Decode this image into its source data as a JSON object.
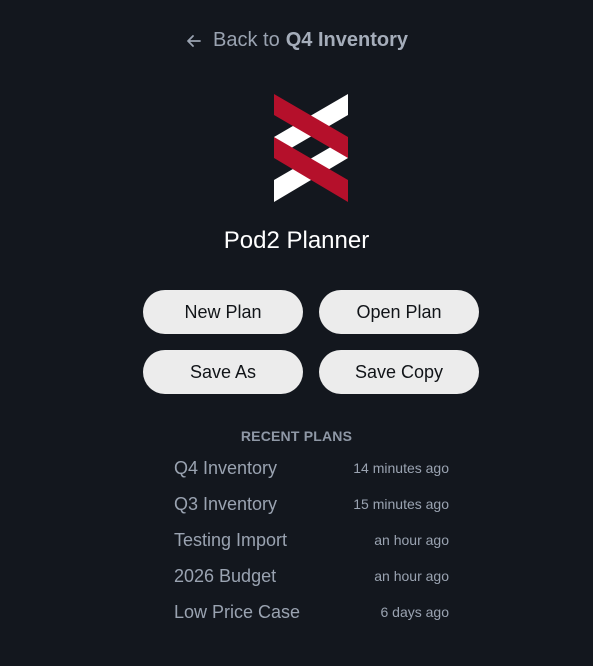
{
  "back": {
    "prefix": "Back to",
    "target": "Q4 Inventory",
    "icon": "arrow-left-icon"
  },
  "app": {
    "title": "Pod2 Planner",
    "logo_icon": "pod2-logo",
    "colors": {
      "accent_red": "#b5102b",
      "logo_white": "#ffffff",
      "background": "#13171e",
      "button_bg": "#ececec"
    }
  },
  "actions": {
    "new_plan": "New Plan",
    "open_plan": "Open Plan",
    "save_as": "Save As",
    "save_copy": "Save Copy"
  },
  "recent": {
    "heading": "RECENT PLANS",
    "items": [
      {
        "name": "Q4 Inventory",
        "time": "14 minutes ago"
      },
      {
        "name": "Q3 Inventory",
        "time": "15 minutes ago"
      },
      {
        "name": "Testing Import",
        "time": "an hour ago"
      },
      {
        "name": "2026 Budget",
        "time": "an hour ago"
      },
      {
        "name": "Low Price Case",
        "time": "6 days ago"
      }
    ]
  }
}
